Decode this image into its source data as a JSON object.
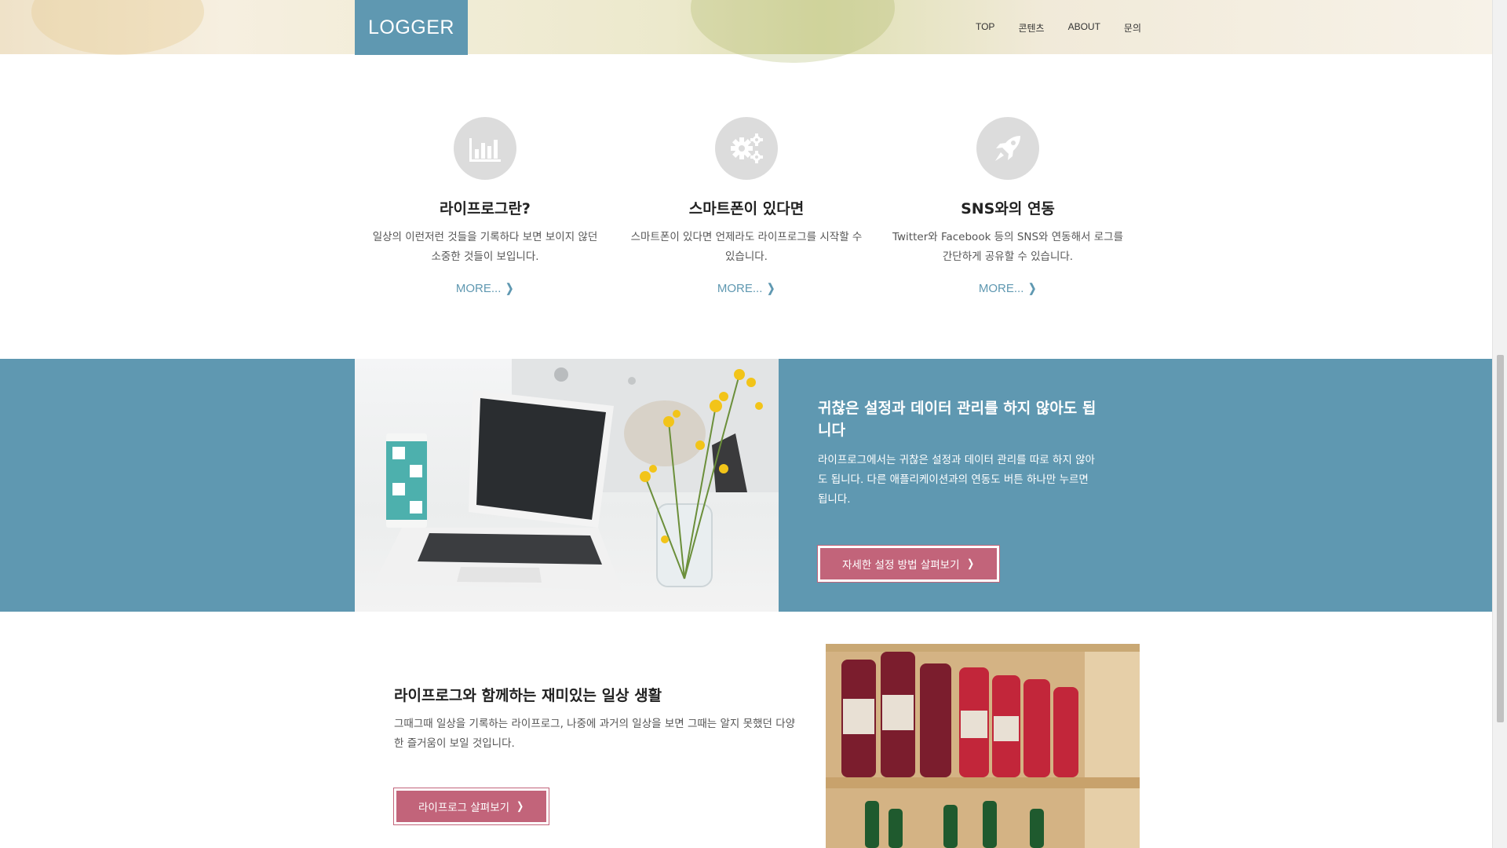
{
  "header": {
    "logo": "LOGGER",
    "nav": [
      "TOP",
      "콘텐츠",
      "ABOUT",
      "문의"
    ]
  },
  "features": [
    {
      "icon": "bar-chart-icon",
      "title": "라이프로그란?",
      "description": "일상의 이런저런 것들을 기록하다 보면 보이지 않던 소중한 것들이 보입니다.",
      "more": "MORE..."
    },
    {
      "icon": "gears-icon",
      "title": "스마트폰이 있다면",
      "description": "스마트폰이 있다면 언제라도 라이프로그를 시작할 수 있습니다.",
      "more": "MORE..."
    },
    {
      "icon": "rocket-icon",
      "title": "SNS와의 연동",
      "description": "Twitter와 Facebook 등의 SNS와 연동해서 로그를 간단하게 공유할 수 있습니다.",
      "more": "MORE..."
    }
  ],
  "band": {
    "title": "귀찮은 설정과 데이터 관리를 하지 않아도 됩니다",
    "description": "라이프로그에서는 귀찮은 설정과 데이터 관리를 따로 하지 않아도 됩니다. 다른 애플리케이션과의 연동도 버튼 하나만 누르면 됩니다.",
    "button": "자세한 설정 방법 살펴보기"
  },
  "bottom": {
    "title": "라이프로그와 함께하는 재미있는 일상 생활",
    "description": "그때그때 일상을 기록하는 라이프로그, 나중에 과거의 일상을 보면 그때는 알지 못했던 다양한 즐거움이 보일 것입니다.",
    "button": "라이프로그 살펴보기"
  },
  "colors": {
    "accent": "#5f98b1",
    "button": "#c2647a"
  }
}
